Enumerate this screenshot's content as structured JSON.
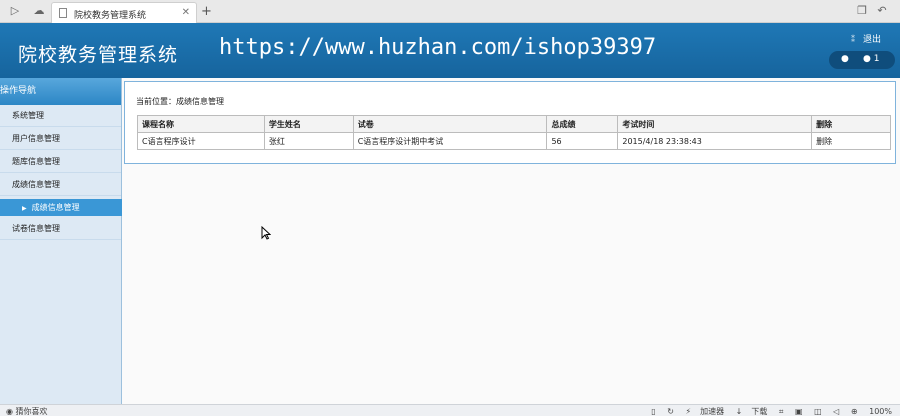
{
  "browser": {
    "tab_title": "院校教务管理系统",
    "new_tab": "+"
  },
  "header": {
    "title": "院校教务管理系统",
    "watermark": "https://www.huzhan.com/ishop39397",
    "exit_label": "退出",
    "user_count": "1"
  },
  "sidebar": {
    "heading": "操作导航",
    "items": [
      {
        "label": "系统管理"
      },
      {
        "label": "用户信息管理"
      },
      {
        "label": "题库信息管理"
      },
      {
        "label": "成绩信息管理"
      }
    ],
    "active_sub": "成绩信息管理",
    "last_item": "试卷信息管理"
  },
  "main": {
    "breadcrumb": "当前位置：成绩信息管理",
    "table": {
      "headers": [
        "课程名称",
        "学生姓名",
        "试卷",
        "总成绩",
        "考试时间",
        "删除"
      ],
      "rows": [
        [
          "C语言程序设计",
          "张红",
          "C语言程序设计期中考试",
          "56",
          "2015/4/18 23:38:43",
          "删除"
        ]
      ]
    }
  },
  "statusbar": {
    "left": "猜你喜欢",
    "accelerator": "加速器",
    "download": "下载",
    "zoom": "100%"
  }
}
